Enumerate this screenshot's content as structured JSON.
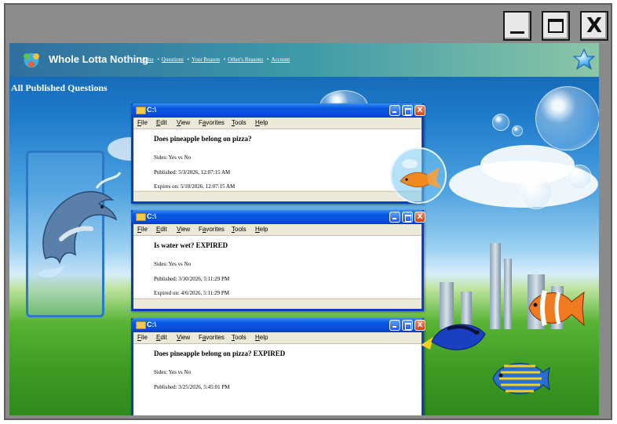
{
  "window_controls": {
    "minimize_glyph": "_",
    "close_glyph": "X"
  },
  "site": {
    "name": "Whole Lotta Nothing",
    "nav": [
      "Home",
      "Questions",
      "Your Reason",
      "Other's Reasons",
      "Account"
    ],
    "nav_separator": "•"
  },
  "page": {
    "heading": "All Published Questions"
  },
  "xp_window": {
    "title": "C:\\",
    "menu": [
      "File",
      "Edit",
      "View",
      "Favorites",
      "Tools",
      "Help"
    ],
    "menu_access_keys": [
      "F",
      "E",
      "V",
      "a",
      "T",
      "H"
    ]
  },
  "questions": [
    {
      "title": "Does pineapple belong on pizza?",
      "sides": "Sides: Yes vs No",
      "published": "Published: 5/3/2026, 12:07:15 AM",
      "expiry": "Expires on: 5/10/2026, 12:07:15 AM"
    },
    {
      "title": "Is water wet? EXPIRED",
      "sides": "Sides: Yes vs No",
      "published": "Published: 3/30/2026, 5:11:29 PM",
      "expiry": "Expired on: 4/6/2026, 5:11:29 PM"
    },
    {
      "title": "Does pineapple belong on pizza? EXPIRED",
      "sides": "Sides: Yes vs No",
      "published": "Published: 3/25/2026, 5:45:01 PM",
      "expiry": ""
    }
  ],
  "colors": {
    "xp_title_blue": "#0a4fd8",
    "xp_close_red": "#d6401a",
    "frame_gray": "#8a8a8a",
    "header_teal": "#3e9aa8"
  },
  "icons": {
    "logo": "globe-people-icon",
    "header_right": "star-icon",
    "xp_folder": "folder-icon"
  }
}
